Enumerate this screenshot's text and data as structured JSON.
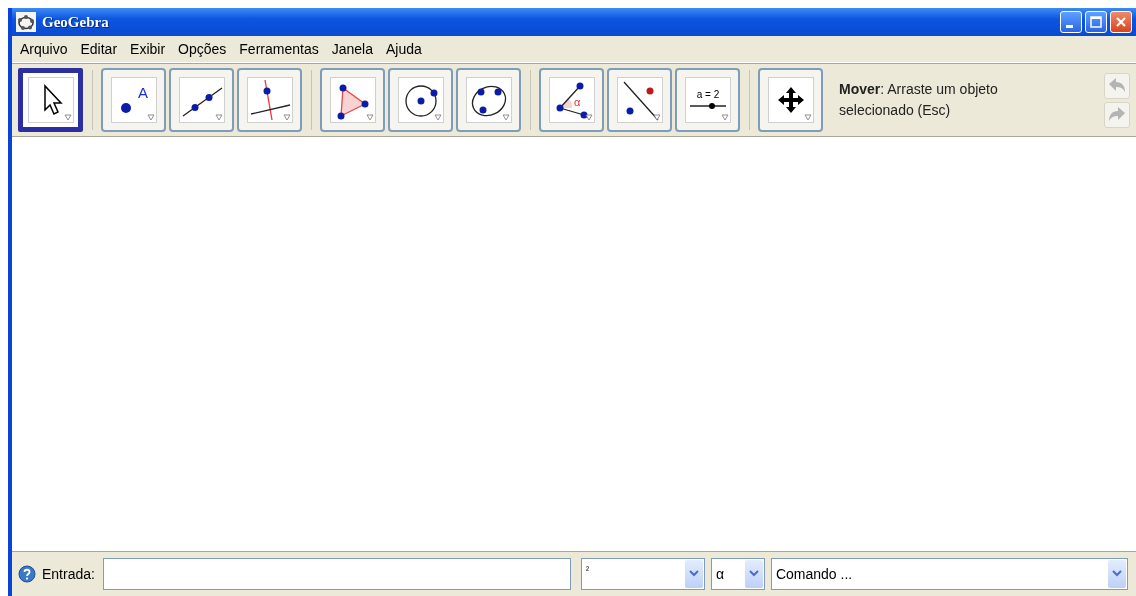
{
  "window": {
    "title": "GeoGebra"
  },
  "menu": [
    "Arquivo",
    "Editar",
    "Exibir",
    "Opções",
    "Ferramentas",
    "Janela",
    "Ajuda"
  ],
  "toolbar": {
    "groups": [
      [
        {
          "kind": "move",
          "selected": true
        }
      ],
      [
        {
          "kind": "point",
          "selected": false,
          "label": "A"
        },
        {
          "kind": "line",
          "selected": false
        },
        {
          "kind": "perpendicular",
          "selected": false
        }
      ],
      [
        {
          "kind": "polygon",
          "selected": false
        },
        {
          "kind": "circle",
          "selected": false
        },
        {
          "kind": "conic",
          "selected": false
        }
      ],
      [
        {
          "kind": "angle",
          "selected": false,
          "label": "α"
        },
        {
          "kind": "reflect",
          "selected": false
        },
        {
          "kind": "slider",
          "selected": false,
          "label": "a = 2"
        }
      ],
      [
        {
          "kind": "pan",
          "selected": false
        }
      ]
    ],
    "help": "**Mover**: Arraste um objeto selecionado (Esc)",
    "undo": {
      "disabled": true
    },
    "redo": {
      "disabled": true
    }
  },
  "input_bar": {
    "label": "Entrada:",
    "symbols": "²",
    "greek": "α",
    "command": "Comando ..."
  }
}
